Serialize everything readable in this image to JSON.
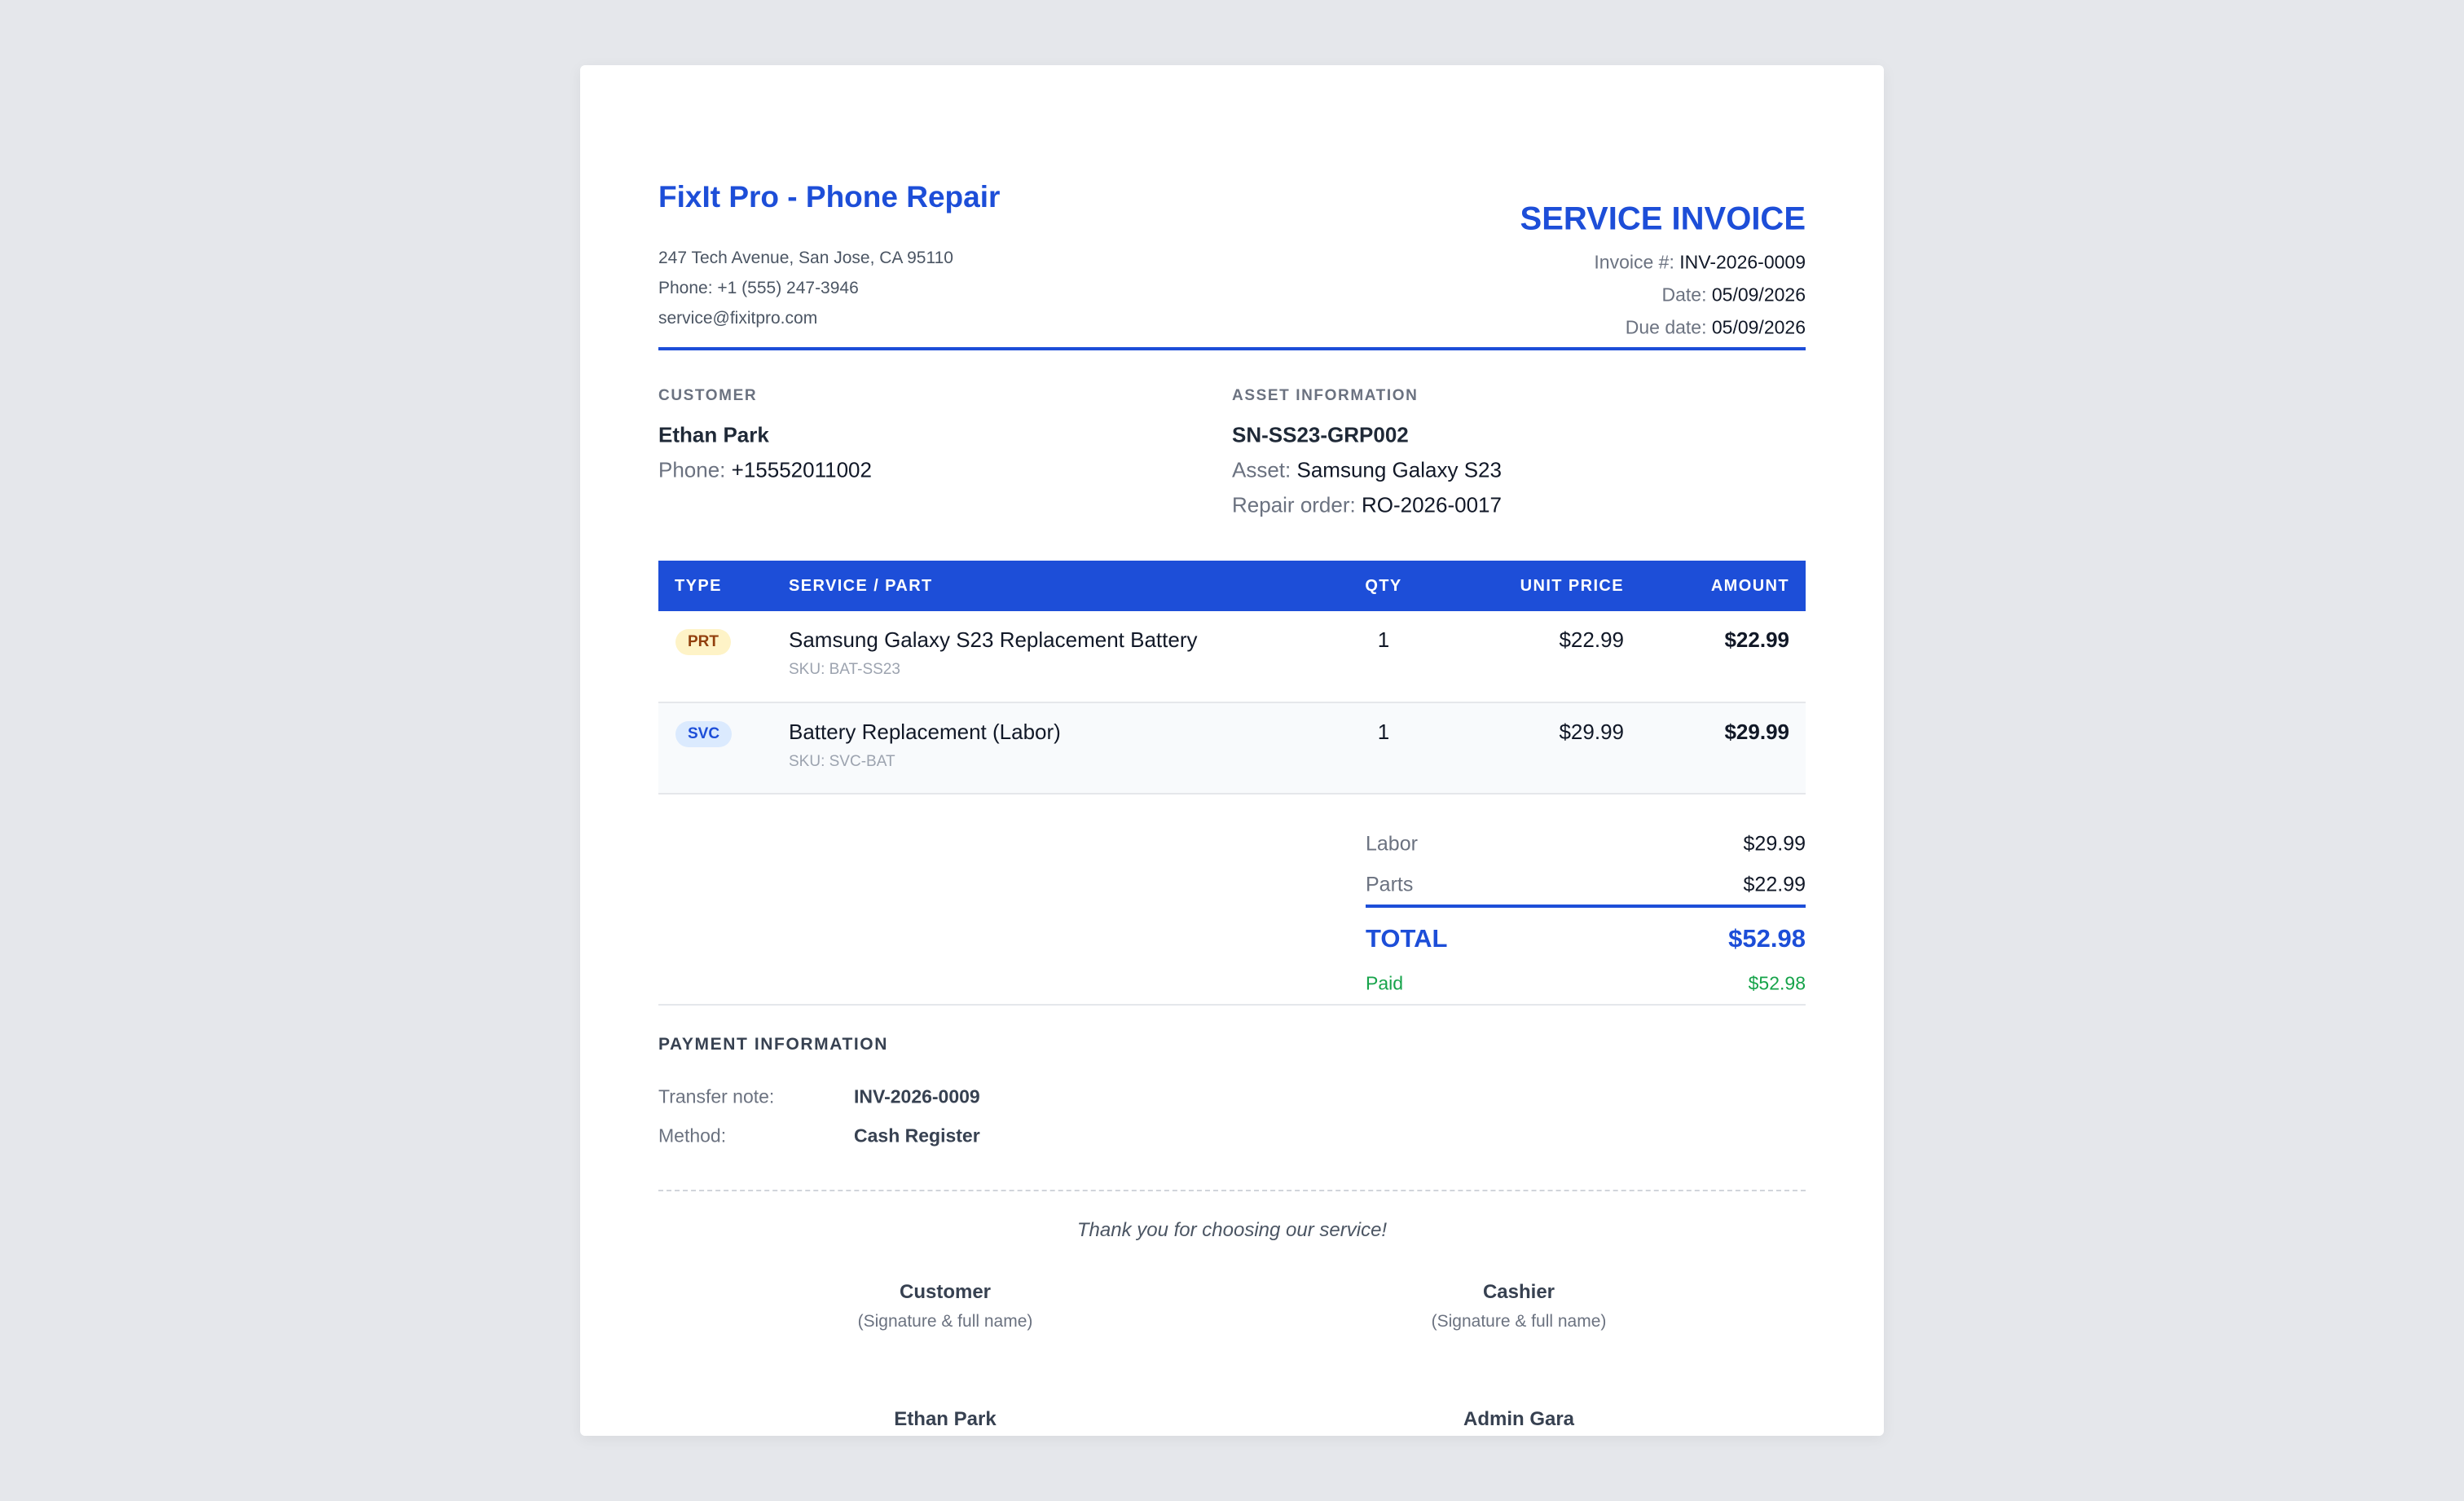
{
  "company": {
    "name": "FixIt Pro - Phone Repair",
    "address": "247 Tech Avenue, San Jose, CA 95110",
    "phone": "Phone: +1 (555) 247-3946",
    "email": "service@fixitpro.com"
  },
  "invoice": {
    "title": "SERVICE INVOICE",
    "number_label": "Invoice #:",
    "number": "INV-2026-0009",
    "date_label": "Date:",
    "date": "05/09/2026",
    "due_label": "Due date:",
    "due": "05/09/2026"
  },
  "customer": {
    "section_label": "CUSTOMER",
    "name": "Ethan Park",
    "phone_label": "Phone:",
    "phone": "+15552011002"
  },
  "asset": {
    "section_label": "ASSET INFORMATION",
    "serial": "SN-SS23-GRP002",
    "asset_label": "Asset:",
    "asset": "Samsung Galaxy S23",
    "order_label": "Repair order:",
    "order": "RO-2026-0017"
  },
  "table": {
    "headers": [
      "TYPE",
      "SERVICE / PART",
      "QTY",
      "UNIT PRICE",
      "AMOUNT"
    ],
    "rows": [
      {
        "type": "PRT",
        "name": "Samsung Galaxy S23 Replacement Battery",
        "sku": "SKU: BAT-SS23",
        "qty": "1",
        "unit": "$22.99",
        "amount": "$22.99"
      },
      {
        "type": "SVC",
        "name": "Battery Replacement (Labor)",
        "sku": "SKU: SVC-BAT",
        "qty": "1",
        "unit": "$29.99",
        "amount": "$29.99"
      }
    ]
  },
  "totals": {
    "labor_label": "Labor",
    "labor": "$29.99",
    "parts_label": "Parts",
    "parts": "$22.99",
    "total_label": "TOTAL",
    "total": "$52.98",
    "paid_label": "Paid",
    "paid": "$52.98"
  },
  "payment": {
    "title": "PAYMENT INFORMATION",
    "note_label": "Transfer note:",
    "note": "INV-2026-0009",
    "method_label": "Method:",
    "method": "Cash Register"
  },
  "footer": {
    "thanks": "Thank you for choosing our service!",
    "sig_hint": "(Signature & full name)",
    "customer_role": "Customer",
    "customer_name": "Ethan Park",
    "cashier_role": "Cashier",
    "cashier_name": "Admin Gara"
  },
  "colors": {
    "accent": "#1d4ed8",
    "paid": "#16a34a",
    "background": "#e5e7eb"
  }
}
